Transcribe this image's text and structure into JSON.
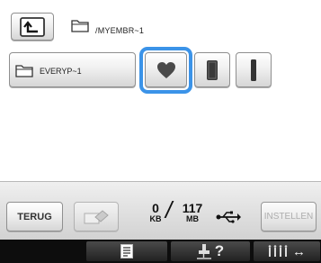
{
  "path": {
    "text": "/MYEMBR~1"
  },
  "folder": {
    "name": "EVERYP~1"
  },
  "patterns": [
    {
      "icon": "heart-icon",
      "selected": true
    },
    {
      "icon": "rectangle-icon",
      "selected": false
    },
    {
      "icon": "bar-icon",
      "selected": false
    }
  ],
  "controls": {
    "back_label": "TERUG",
    "settings_label": "INSTELLEN",
    "memory_used": "0",
    "memory_used_unit": "KB",
    "memory_total": "117",
    "memory_total_unit": "MB"
  },
  "strip": {
    "help_symbol": "?",
    "thread_arrow": "↔"
  },
  "colors": {
    "selection": "#3b93e8",
    "strip_bg": "#0d0d0d"
  }
}
